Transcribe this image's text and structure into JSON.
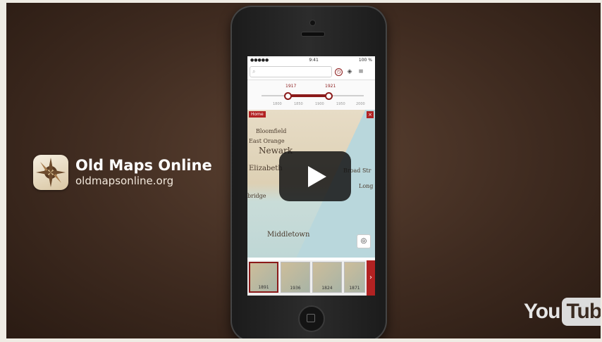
{
  "brand": {
    "name": "Old Maps Online",
    "url": "oldmapsonline.org"
  },
  "phone": {
    "status_carrier": "●●●●● ",
    "status_time": "9:41",
    "status_battery": "100 %",
    "search_placeholder": "",
    "timeline": {
      "start_year": "1917",
      "end_year": "1921",
      "ticks": [
        "1800",
        "1850",
        "1900",
        "1950",
        "2000"
      ]
    },
    "home_tag": "Home",
    "close_tag": "×",
    "map_labels": {
      "bloomfield": "Bloomfield",
      "east_orange": "East Orange",
      "newark": "Newark",
      "elizabeth": "Elizabeth",
      "broad_st": "Broad Str",
      "long": "Long",
      "bridge": "bridge",
      "middletown": "Middletown"
    },
    "thumbnails": [
      {
        "year": "1891"
      },
      {
        "year": "1936"
      },
      {
        "year": "1824"
      },
      {
        "year": "1871"
      }
    ]
  },
  "youtube": {
    "you": "You",
    "tube": "Tube"
  },
  "colors": {
    "accent": "#8b1a1a",
    "background": "#3f2b20"
  }
}
